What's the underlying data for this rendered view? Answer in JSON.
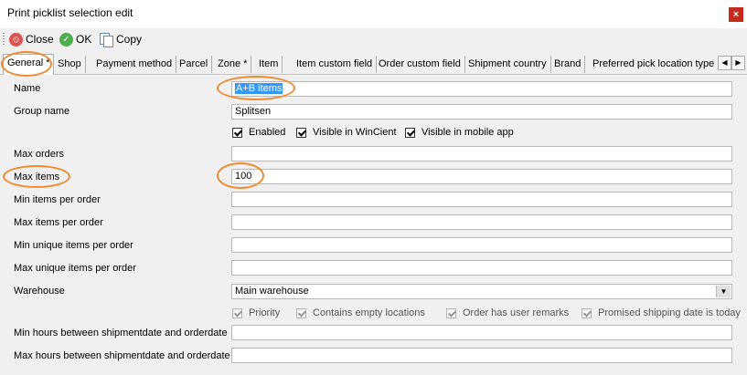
{
  "window": {
    "title": "Print picklist selection edit",
    "close_glyph": "×"
  },
  "toolbar": {
    "close_label": "Close",
    "ok_label": "OK",
    "copy_label": "Copy"
  },
  "tabs": [
    {
      "label": "General *",
      "active": true
    },
    {
      "label": "Shop"
    },
    {
      "label": "Payment method"
    },
    {
      "label": "Parcel"
    },
    {
      "label": "Zone *"
    },
    {
      "label": "Item"
    },
    {
      "label": "Item custom field"
    },
    {
      "label": "Order custom field"
    },
    {
      "label": "Shipment country"
    },
    {
      "label": "Brand"
    },
    {
      "label": "Preferred pick location type"
    }
  ],
  "form": {
    "name": {
      "label": "Name",
      "value": "A+B items"
    },
    "group_name": {
      "label": "Group name",
      "value": "Splitsen"
    },
    "enabled": {
      "label": "Enabled",
      "checked": true
    },
    "visible_wincient": {
      "label": "Visible in WinCient",
      "checked": true
    },
    "visible_mobile": {
      "label": "Visible in mobile app",
      "checked": true
    },
    "max_orders": {
      "label": "Max orders",
      "value": ""
    },
    "max_items": {
      "label": "Max items",
      "value": "100"
    },
    "min_items_per_order": {
      "label": "Min items per order",
      "value": ""
    },
    "max_items_per_order": {
      "label": "Max items per order",
      "value": ""
    },
    "min_unique_items_per_order": {
      "label": "Min unique items per order",
      "value": ""
    },
    "max_unique_items_per_order": {
      "label": "Max unique items per order",
      "value": ""
    },
    "warehouse": {
      "label": "Warehouse",
      "value": "Main warehouse"
    },
    "priority": {
      "label": "Priority",
      "checked": true
    },
    "contains_empty_locations": {
      "label": "Contains empty locations",
      "checked": true
    },
    "order_has_user_remarks": {
      "label": "Order has user remarks",
      "checked": true
    },
    "promised_shipping_today": {
      "label": "Promised shipping date is today",
      "checked": true
    },
    "min_hours": {
      "label": "Min hours between shipmentdate and orderdate",
      "value": ""
    },
    "max_hours": {
      "label": "Max hours between shipmentdate and orderdate",
      "value": ""
    }
  },
  "colors": {
    "annotation": "#f08a30",
    "selection": "#3399ff",
    "close_button": "#c42b1c"
  }
}
